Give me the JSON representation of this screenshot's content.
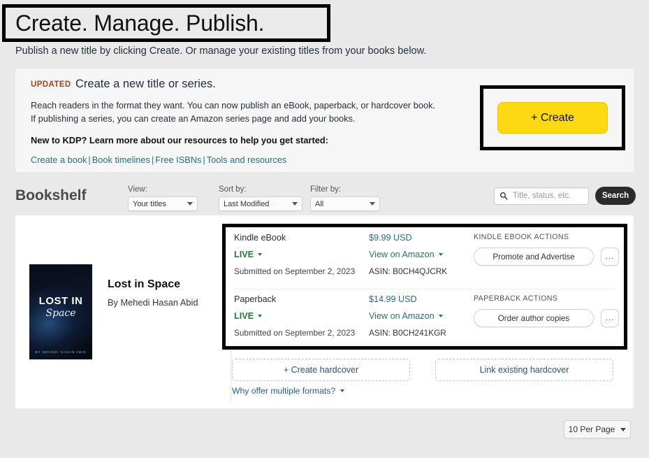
{
  "hero": {
    "title": "Create. Manage. Publish.",
    "subtitle": "Publish a new title by clicking Create. Or manage your existing titles from your books below."
  },
  "create_card": {
    "badge": "UPDATED",
    "title": "Create a new title or series.",
    "body": "Reach readers in the format they want. You can now publish an eBook, paperback, or hardcover book. If publishing a series, you can create an Amazon series page and add your books.",
    "strong_line": "New to KDP? Learn more about our resources to help you get started:",
    "links": [
      {
        "label": "Create a book"
      },
      {
        "label": "Book timelines"
      },
      {
        "label": "Free ISBNs"
      },
      {
        "label": "Tools and resources"
      }
    ],
    "link_separator": "|",
    "create_button": "+ Create",
    "create_button_color": "#fcd913"
  },
  "bookshelf": {
    "title": "Bookshelf",
    "controls": [
      {
        "label": "View:",
        "value": "Your titles"
      },
      {
        "label": "Sort by:",
        "value": "Last Modified"
      },
      {
        "label": "Filter by:",
        "value": "All"
      }
    ],
    "search": {
      "placeholder": "Title, status, etc.",
      "value": "",
      "button": "Search"
    }
  },
  "book": {
    "title": "Lost in Space",
    "author": "By Mehedi Hasan Abid",
    "cover": {
      "line1": "LOST IN",
      "line2": "Space",
      "line3": "BY MEHEDI HASAN ABID"
    },
    "formats": [
      {
        "name": "Kindle eBook",
        "status": "LIVE",
        "status_color": "#217a3c",
        "submitted": "Submitted on September 2, 2023",
        "price": "$9.99 USD",
        "view_link": "View on Amazon",
        "asin": "ASIN: B0CH4QJCRK",
        "actions_label": "KINDLE EBOOK ACTIONS",
        "primary_action": "Promote and Advertise",
        "more_action": "..."
      },
      {
        "name": "Paperback",
        "status": "LIVE",
        "status_color": "#217a3c",
        "submitted": "Submitted on September 2, 2023",
        "price": "$14.99 USD",
        "view_link": "View on Amazon",
        "asin": "ASIN: B0CH241KGR",
        "actions_label": "PAPERBACK ACTIONS",
        "primary_action": "Order author copies",
        "more_action": "..."
      }
    ],
    "hardcover": {
      "create_label": "+ Create hardcover",
      "link_label": "Link existing hardcover"
    },
    "why_formats": "Why offer multiple formats?"
  },
  "pagination": {
    "per_page": "10 Per Page"
  }
}
